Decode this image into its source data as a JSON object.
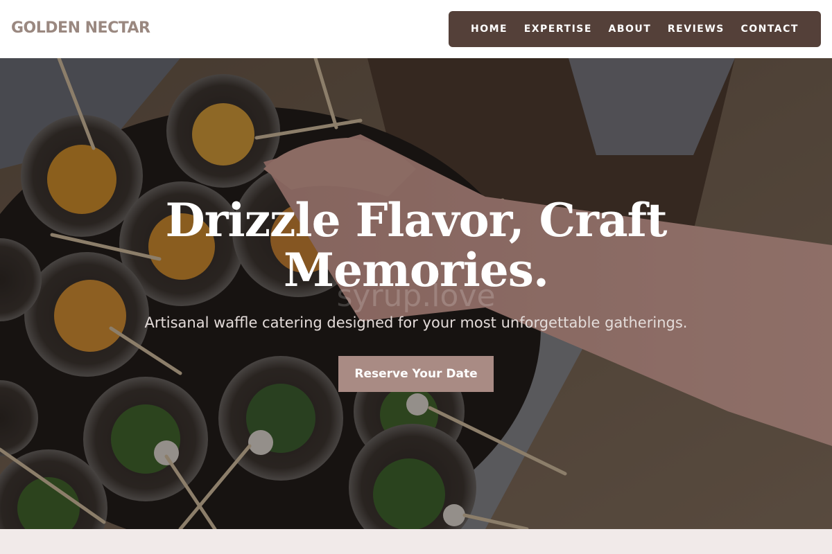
{
  "brand": {
    "name": "GOLDEN NECTAR"
  },
  "nav": {
    "items": [
      {
        "label": "HOME"
      },
      {
        "label": "EXPERTISE"
      },
      {
        "label": "ABOUT"
      },
      {
        "label": "REVIEWS"
      },
      {
        "label": "CONTACT"
      }
    ]
  },
  "hero": {
    "title_line1": "Drizzle Flavor, Craft",
    "title_line2": "Memories.",
    "watermark": "syrup.love",
    "subtitle": "Artisanal waffle catering designed for your most unforgettable gatherings.",
    "cta_label": "Reserve Your Date"
  },
  "colors": {
    "nav_bg": "#544039",
    "logo": "#9a8880",
    "cta_bg": "#a98b84",
    "footer_strip": "#f1eae9"
  }
}
